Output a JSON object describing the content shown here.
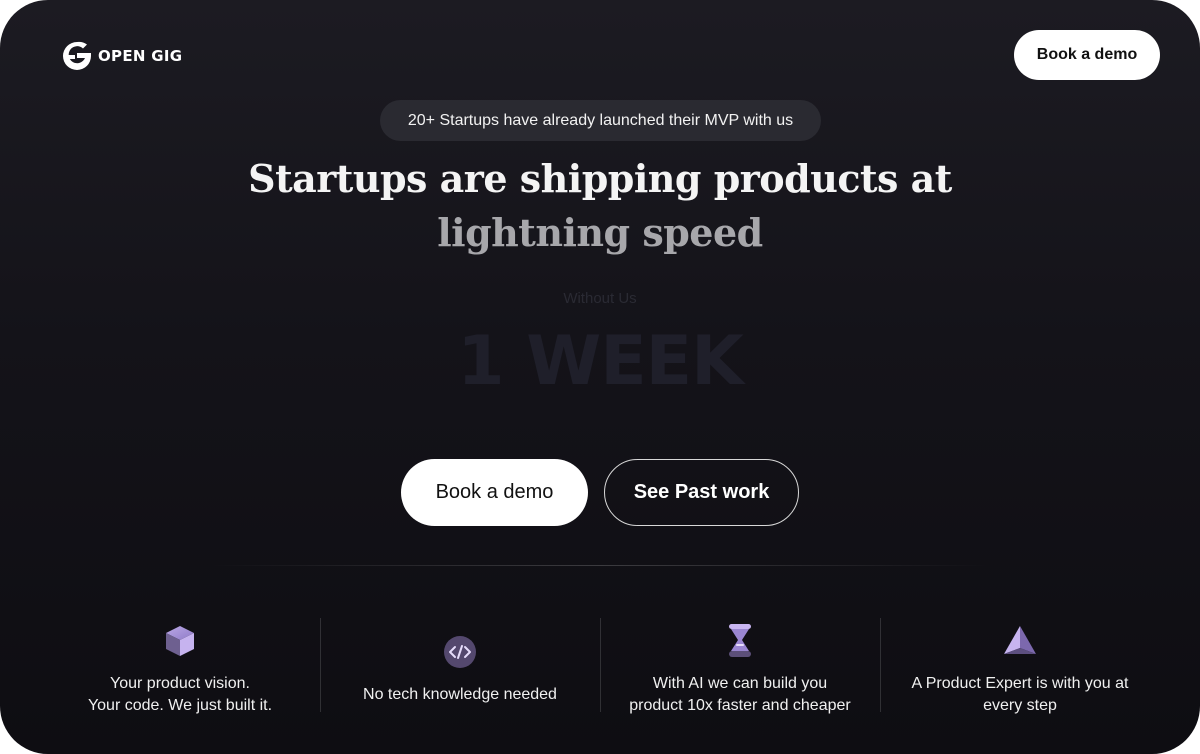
{
  "header": {
    "logo_text": "OPEN GIG",
    "cta_label": "Book a demo"
  },
  "hero": {
    "pill_text": "20+ Startups have already launched their MVP with us",
    "headline_line1": "Startups are shipping products at",
    "headline_line2": "lightning speed",
    "comparison_label": "Without Us",
    "comparison_value": "1 WEEK",
    "primary_cta": "Book a demo",
    "secondary_cta": "See Past work"
  },
  "features": [
    {
      "icon": "cube-icon",
      "text": "Your product vision.\nYour code. We just built it."
    },
    {
      "icon": "code-icon",
      "text": "No tech knowledge needed"
    },
    {
      "icon": "hourglass-icon",
      "text": "With AI we can build you product 10x faster and cheaper"
    },
    {
      "icon": "pyramid-icon",
      "text": "A  Product Expert is with you at every step"
    }
  ],
  "colors": {
    "background": "#141319",
    "accent_purple": "#9b86d6",
    "button_bg": "#ffffff"
  }
}
